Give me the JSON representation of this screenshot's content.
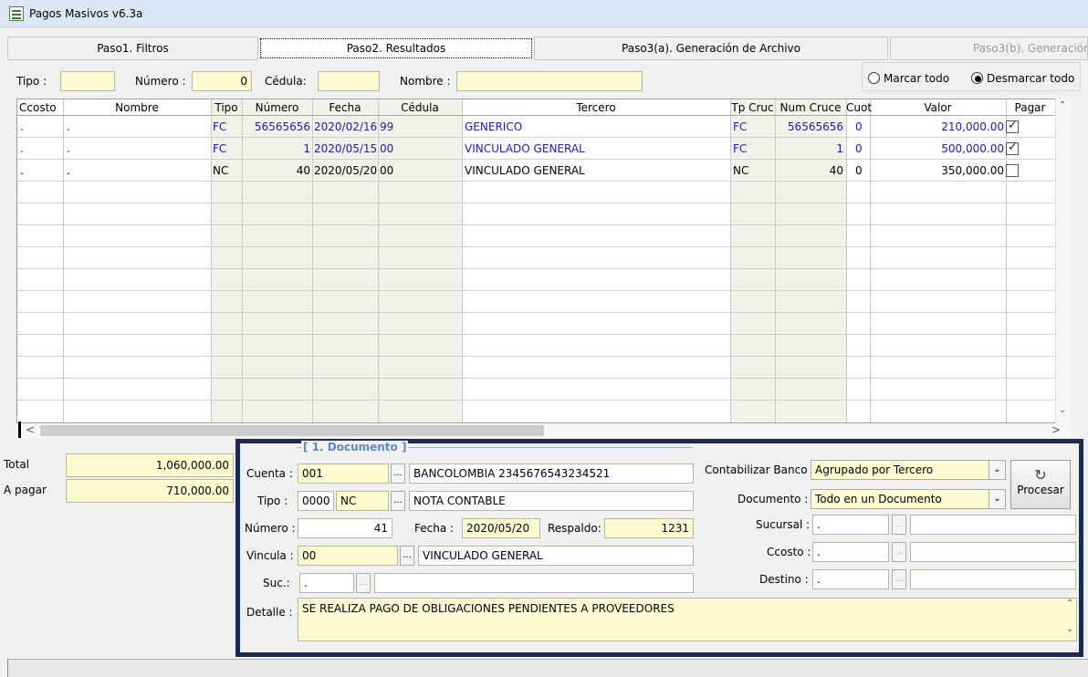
{
  "window": {
    "title": "Pagos Masivos v6.3a"
  },
  "tabs": [
    {
      "label": "Paso1. Filtros"
    },
    {
      "label": "Paso2. Resultados"
    },
    {
      "label": "Paso3(a). Generación de Archivo"
    },
    {
      "label": "Paso3(b). Generación"
    }
  ],
  "filters": {
    "tipo_label": "Tipo :",
    "tipo_value": "",
    "numero_label": "Número :",
    "numero_value": "0",
    "cedula_label": "Cédula:",
    "cedula_value": "",
    "nombre_label": "Nombre :",
    "nombre_value": "",
    "marcar_todo": "Marcar todo",
    "desmarcar_todo": "Desmarcar todo"
  },
  "grid": {
    "headers": [
      "Ccosto",
      "Nombre",
      "Tipo",
      "Número",
      "Fecha",
      "Cédula",
      "Tercero",
      "Tp Cruc",
      "Num Cruce",
      "Cuot",
      "Valor",
      "Pagar"
    ],
    "rows": [
      {
        "ccosto": ".",
        "nombre": ".",
        "tipo": "FC",
        "numero": "56565656",
        "fecha": "2020/02/16",
        "cedula": "99",
        "tercero": "GENERICO",
        "tpcruc": "FC",
        "numcruce": "56565656",
        "cuot": "0",
        "valor": "210,000.00",
        "pagar": true,
        "color": "blue"
      },
      {
        "ccosto": ".",
        "nombre": ".",
        "tipo": "FC",
        "numero": "1",
        "fecha": "2020/05/15",
        "cedula": "00",
        "tercero": "VINCULADO GENERAL",
        "tpcruc": "FC",
        "numcruce": "1",
        "cuot": "0",
        "valor": "500,000.00",
        "pagar": true,
        "color": "blue"
      },
      {
        "ccosto": ".",
        "nombre": ".",
        "tipo": "NC",
        "numero": "40",
        "fecha": "2020/05/20",
        "cedula": "00",
        "tercero": "VINCULADO GENERAL",
        "tpcruc": "NC",
        "numcruce": "40",
        "cuot": "0",
        "valor": "350,000.00",
        "pagar": false,
        "color": "black"
      }
    ]
  },
  "totals": {
    "total_label": "Total",
    "total_value": "1,060,000.00",
    "apagar_label": "A pagar",
    "apagar_value": "710,000.00"
  },
  "documento": {
    "legend": "[ 1. Documento ]",
    "cuenta_label": "Cuenta :",
    "cuenta_code": "001",
    "cuenta_desc": "BANCOLOMBIA 2345676543234521",
    "tipo_label": "Tipo :",
    "tipo_code": "0000",
    "tipo_abbr": "NC",
    "tipo_desc": "NOTA CONTABLE",
    "numero_label": "Número :",
    "numero_value": "41",
    "fecha_label": "Fecha :",
    "fecha_value": "2020/05/20",
    "respaldo_label": "Respaldo:",
    "respaldo_value": "1231",
    "vincula_label": "Vincula :",
    "vincula_code": "00",
    "vincula_desc": "VINCULADO GENERAL",
    "suc_label": "Suc.:",
    "suc_value": ".",
    "detalle_label": "Detalle :",
    "detalle_value": "SE REALIZA PAGO DE OBLIGACIONES PENDIENTES A PROVEEDORES",
    "contabilizar_label": "Contabilizar Banco :",
    "contabilizar_value": "Agrupado por Tercero",
    "documento_label": "Documento :",
    "documento_value": "Todo en un Documento",
    "sucursal_label": "Sucursal :",
    "sucursal_value": ".",
    "ccosto_label": "Ccosto :",
    "ccosto_value": ".",
    "destino_label": "Destino :",
    "destino_value": ".",
    "procesar_label": "Procesar",
    "ellipsis": "..."
  }
}
